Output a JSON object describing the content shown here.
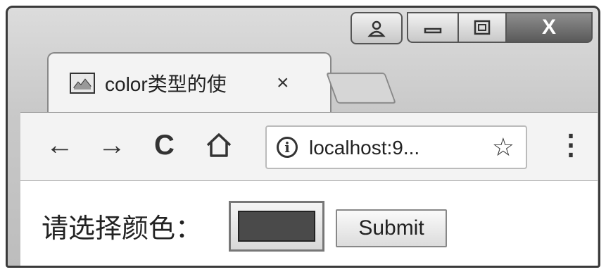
{
  "tab": {
    "title": "color类型的使",
    "close": "×"
  },
  "window_controls": {
    "close": "X"
  },
  "toolbar": {
    "back": "←",
    "forward": "→",
    "reload": "C",
    "home": "⌂",
    "info": "i",
    "url": "localhost:9...",
    "star": "☆",
    "menu": "⋮"
  },
  "form": {
    "label": "请选择颜色：",
    "color_value": "#4a4a4a",
    "submit_label": "Submit"
  }
}
